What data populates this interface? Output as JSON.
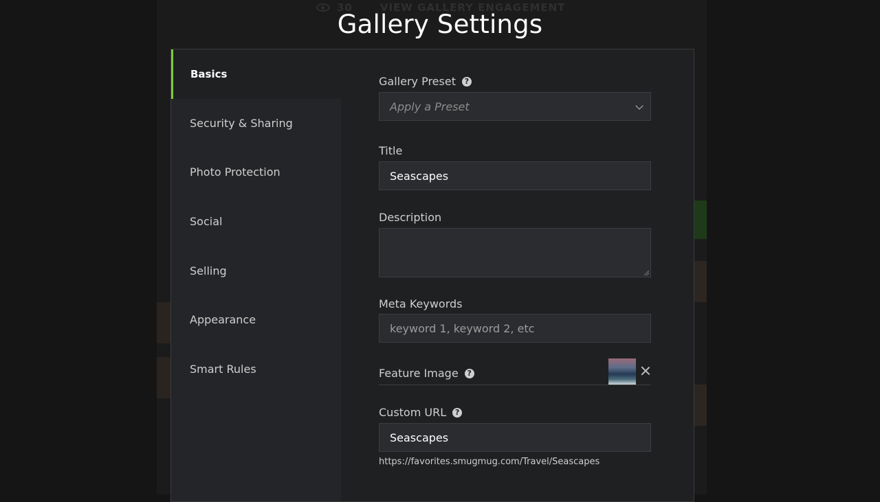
{
  "page": {
    "title": "Gallery Settings"
  },
  "background": {
    "view_count": "30",
    "view_engagement_label": "VIEW GALLERY ENGAGEMENT"
  },
  "sidebar": {
    "items": [
      {
        "label": "Basics",
        "active": true
      },
      {
        "label": "Security & Sharing",
        "active": false
      },
      {
        "label": "Photo Protection",
        "active": false
      },
      {
        "label": "Social",
        "active": false
      },
      {
        "label": "Selling",
        "active": false
      },
      {
        "label": "Appearance",
        "active": false
      },
      {
        "label": "Smart Rules",
        "active": false
      }
    ]
  },
  "form": {
    "gallery_preset": {
      "label": "Gallery Preset",
      "placeholder": "Apply a Preset",
      "help_icon": "question-circle-icon"
    },
    "title": {
      "label": "Title",
      "value": "Seascapes"
    },
    "description": {
      "label": "Description",
      "value": ""
    },
    "meta_keywords": {
      "label": "Meta Keywords",
      "placeholder": "keyword 1, keyword 2, etc"
    },
    "feature_image": {
      "label": "Feature Image",
      "help_icon": "question-circle-icon"
    },
    "custom_url": {
      "label": "Custom URL",
      "value": "Seascapes",
      "help_icon": "question-circle-icon",
      "hint": "https://favorites.smugmug.com/Travel/Seascapes"
    }
  },
  "colors": {
    "accent": "#7fcb3a",
    "modal_bg": "#1f2022",
    "sidebar_bg": "#242528"
  }
}
